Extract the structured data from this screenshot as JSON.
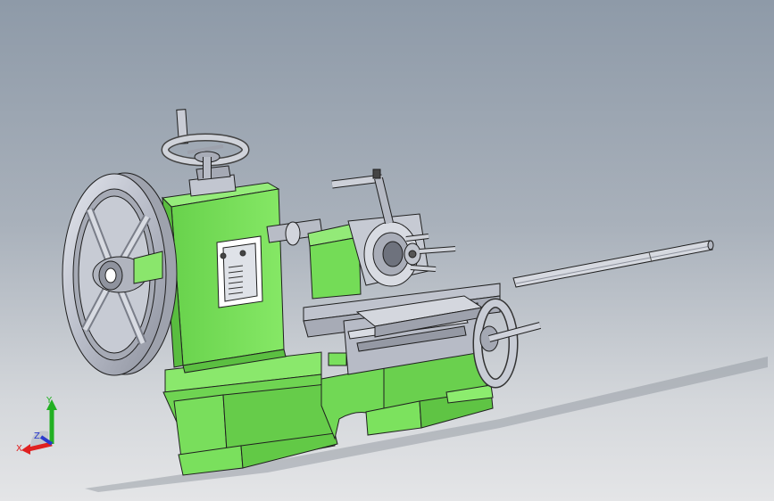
{
  "viewport": {
    "background_top": "#8e9aa8",
    "background_bottom": "#e4e5e7"
  },
  "model": {
    "body_color": "#77e05a",
    "metal_color": "#c8ccd6",
    "outline_color": "#1f1f1f"
  },
  "triad": {
    "x_label": "X",
    "y_label": "Y",
    "z_label": "Z",
    "x_color": "#e02020",
    "y_color": "#22b022",
    "z_color": "#2a3acc"
  }
}
